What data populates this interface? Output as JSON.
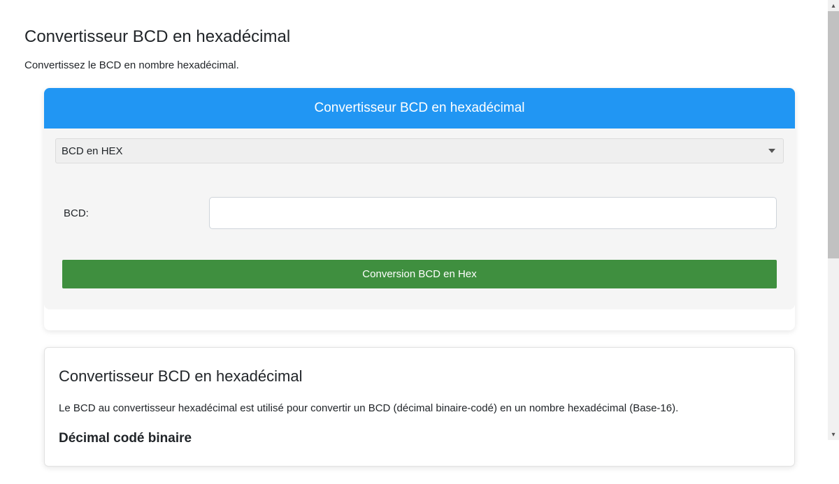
{
  "page": {
    "title": "Convertisseur BCD en hexadécimal",
    "description": "Convertissez le BCD en nombre hexadécimal."
  },
  "converter": {
    "panel_title": "Convertisseur BCD en hexadécimal",
    "select_value": "BCD en HEX",
    "input_label": "BCD:",
    "input_value": "",
    "button_label": "Conversion BCD en Hex"
  },
  "info": {
    "heading": "Convertisseur BCD en hexadécimal",
    "paragraph": "Le BCD au convertisseur hexadécimal est utilisé pour convertir un BCD (décimal binaire-codé) en un nombre hexadécimal (Base-16).",
    "subheading": "Décimal codé binaire"
  },
  "colors": {
    "panel_header": "#2196f3",
    "button": "#3f8f3f"
  }
}
